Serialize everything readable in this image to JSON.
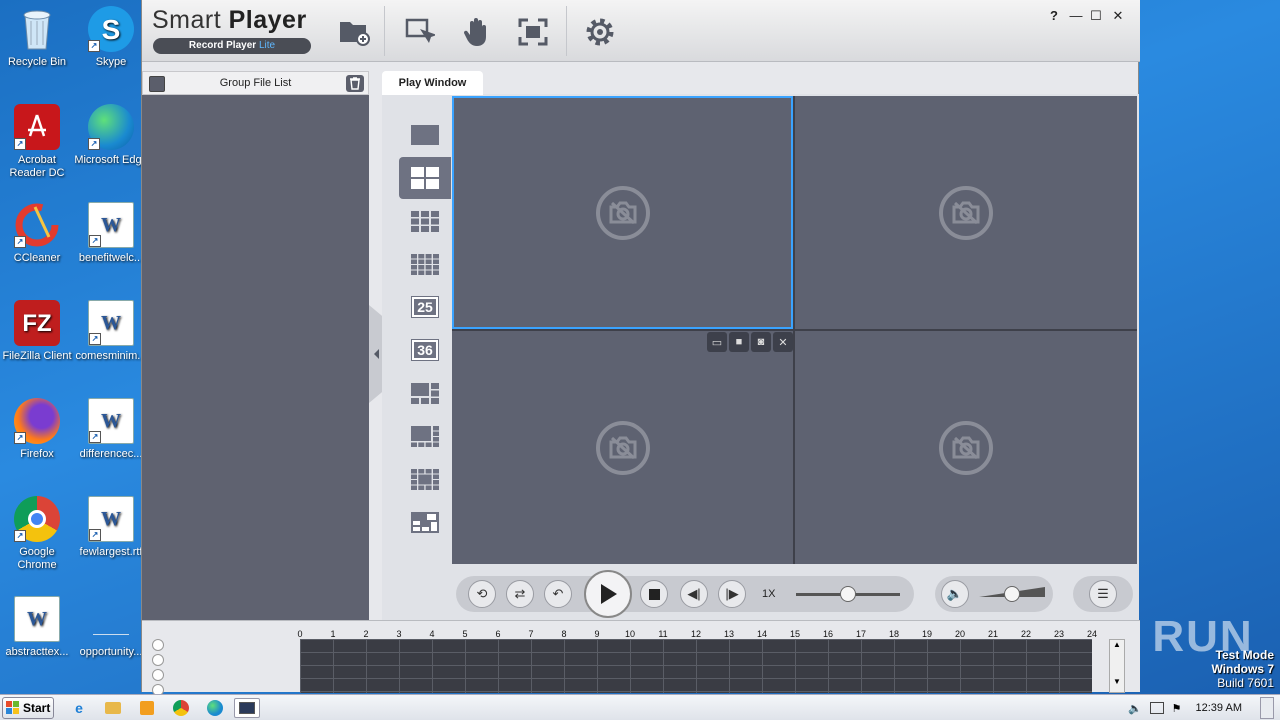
{
  "desktop": {
    "icons": [
      {
        "label": "Recycle Bin",
        "icon": "recycle-bin-icon"
      },
      {
        "label": "Skype",
        "icon": "skype-icon"
      },
      {
        "label": "Acrobat Reader DC",
        "icon": "acrobat-icon"
      },
      {
        "label": "Microsoft Edge",
        "icon": "edge-icon"
      },
      {
        "label": "CCleaner",
        "icon": "ccleaner-icon"
      },
      {
        "label": "benefitwelc...",
        "icon": "word-doc-icon"
      },
      {
        "label": "FileZilla Client",
        "icon": "filezilla-icon"
      },
      {
        "label": "comesminim...",
        "icon": "word-doc-icon"
      },
      {
        "label": "Firefox",
        "icon": "firefox-icon"
      },
      {
        "label": "differencec...",
        "icon": "word-doc-icon"
      },
      {
        "label": "Google Chrome",
        "icon": "chrome-icon"
      },
      {
        "label": "fewlargest.rtf",
        "icon": "word-doc-icon"
      },
      {
        "label": "abstracttex...",
        "icon": "word-doc-icon"
      },
      {
        "label": "opportunity...",
        "icon": "blank-doc-icon"
      }
    ]
  },
  "app": {
    "title_light": "Smart ",
    "title_bold": "Player",
    "subtitle": "Record Player ",
    "subtitle_lite": "Lite",
    "toolbar": [
      "open-folder-icon",
      "select-cursor-icon",
      "hand-drag-icon",
      "fullscreen-icon",
      "settings-gear-icon"
    ],
    "window_controls": {
      "help": "?",
      "minimize": "—",
      "maximize": "☐",
      "close": "✕"
    },
    "left_panel": {
      "title": "Group File List"
    },
    "tab": {
      "label": "Play Window"
    },
    "layouts": [
      {
        "name": "layout-1",
        "label": ""
      },
      {
        "name": "layout-4",
        "label": "",
        "active": true
      },
      {
        "name": "layout-9",
        "label": ""
      },
      {
        "name": "layout-16",
        "label": ""
      },
      {
        "name": "layout-25",
        "label": "25"
      },
      {
        "name": "layout-36",
        "label": "36"
      },
      {
        "name": "layout-6",
        "label": ""
      },
      {
        "name": "layout-8",
        "label": ""
      },
      {
        "name": "layout-13",
        "label": ""
      },
      {
        "name": "layout-custom",
        "label": ""
      }
    ],
    "controls": {
      "speed": "1X",
      "speed_level": 0.5,
      "volume_level": 0.5
    },
    "timeline": {
      "hours": [
        "0",
        "1",
        "2",
        "3",
        "4",
        "5",
        "6",
        "7",
        "8",
        "9",
        "10",
        "11",
        "12",
        "13",
        "14",
        "15",
        "16",
        "17",
        "18",
        "19",
        "20",
        "21",
        "22",
        "23",
        "24"
      ]
    }
  },
  "watermark": {
    "text": "ANY RUN"
  },
  "system": {
    "test_mode": "Test Mode",
    "os": "Windows 7",
    "build": "Build 7601",
    "start": "Start",
    "clock": "12:39 AM"
  }
}
